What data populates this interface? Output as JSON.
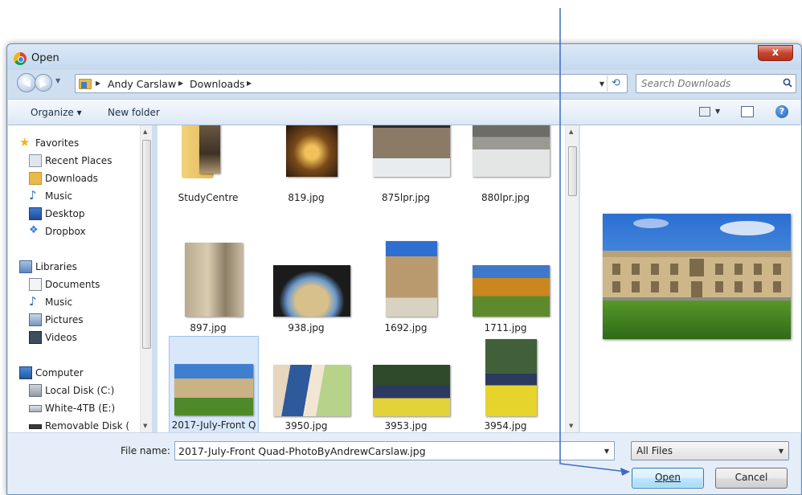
{
  "dialog": {
    "title": "Open",
    "close_glyph": "x"
  },
  "address_bar": {
    "breadcrumbs": [
      "Andy Carslaw",
      "Downloads"
    ],
    "search_placeholder": "Search Downloads"
  },
  "toolbar": {
    "organize_label": "Organize ▾",
    "new_folder_label": "New folder",
    "help_glyph": "?"
  },
  "navigation": {
    "favorites_label": "Favorites",
    "favorites": [
      "Recent Places",
      "Downloads",
      "Music",
      "Desktop",
      "Dropbox"
    ],
    "libraries_label": "Libraries",
    "libraries": [
      "Documents",
      "Music",
      "Pictures",
      "Videos"
    ],
    "computer_label": "Computer",
    "drives": [
      "Local Disk (C:)",
      "White-4TB (E:)",
      "Removable Disk ("
    ]
  },
  "files": [
    {
      "name": "StudyCentre",
      "kind": "folder"
    },
    {
      "name": "819.jpg",
      "kind": "image"
    },
    {
      "name": "875lpr.jpg",
      "kind": "image"
    },
    {
      "name": "880lpr.jpg",
      "kind": "image"
    },
    {
      "name": "897.jpg",
      "kind": "image"
    },
    {
      "name": "938.jpg",
      "kind": "image"
    },
    {
      "name": "1692.jpg",
      "kind": "image"
    },
    {
      "name": "1711.jpg",
      "kind": "image"
    },
    {
      "name": "2017-July-Front Quad-PhotoByAndrewCarslaw.jpg",
      "kind": "image",
      "selected": true
    },
    {
      "name": "3950.jpg",
      "kind": "image"
    },
    {
      "name": "3953.jpg",
      "kind": "image"
    },
    {
      "name": "3954.jpg",
      "kind": "image"
    }
  ],
  "footer": {
    "file_name_label": "File name:",
    "file_name_value": "2017-July-Front Quad-PhotoByAndrewCarslaw.jpg",
    "file_type_value": "All Files",
    "open_label": "Open",
    "cancel_label": "Cancel"
  },
  "colors": {
    "annotation_arrow": "#3a6cc0",
    "selection": "#d8e8fa",
    "window_frame": "#cfdff0"
  }
}
